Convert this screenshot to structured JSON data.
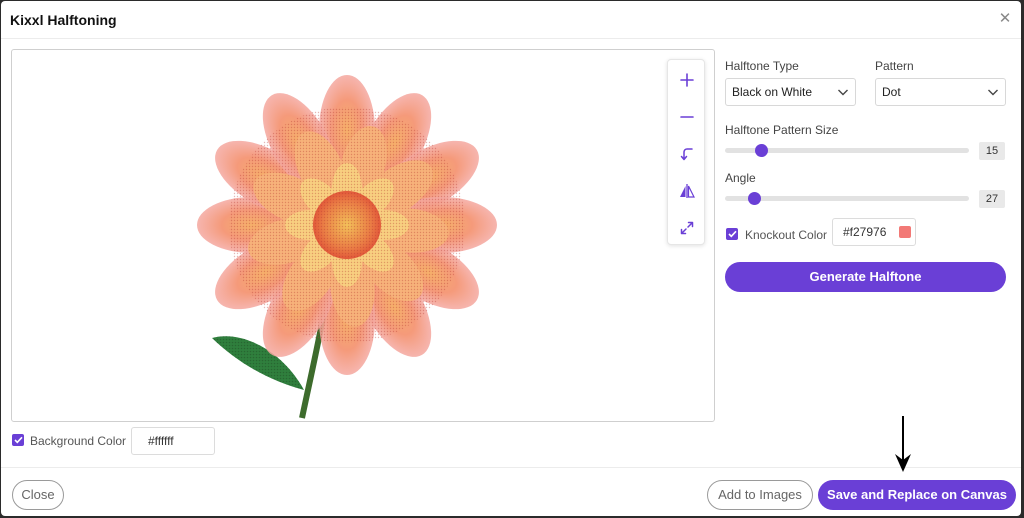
{
  "dialog": {
    "title": "Kixxl Halftoning",
    "close_icon": "close-icon"
  },
  "preview": {
    "image_subject": "halftoned-dahlia-flower",
    "toolbar": [
      "zoom-in-icon",
      "zoom-out-icon",
      "rotate-icon",
      "flip-icon",
      "expand-icon"
    ]
  },
  "background": {
    "checked": true,
    "label": "Background Color",
    "value": "#ffffff"
  },
  "settings": {
    "halftone_type_label": "Halftone Type",
    "halftone_type_value": "Black on White",
    "pattern_label": "Pattern",
    "pattern_value": "Dot",
    "size_label": "Halftone Pattern Size",
    "size_value": "15",
    "size_fraction": 0.13,
    "angle_label": "Angle",
    "angle_value": "27",
    "angle_fraction": 0.1,
    "knockout_checked": true,
    "knockout_label": "Knockout Color",
    "knockout_value": "#f27976",
    "knockout_swatch": "#f27976",
    "generate_label": "Generate Halftone"
  },
  "footer": {
    "close_label": "Close",
    "add_label": "Add to Images",
    "save_label": "Save and Replace on Canvas"
  },
  "colors": {
    "accent": "#6a3fd6"
  }
}
